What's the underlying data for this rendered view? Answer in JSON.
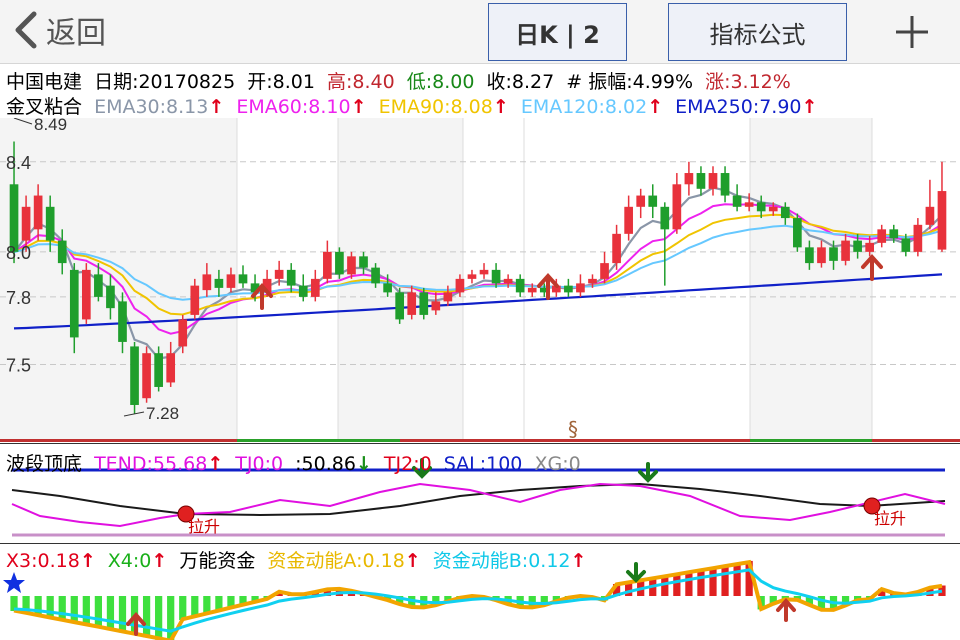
{
  "nav": {
    "back_label": "返回",
    "period_label": "日K | 2",
    "formula_label": "指标公式",
    "add_icon": "plus-icon",
    "back_icon": "chevron-left-icon"
  },
  "quote": {
    "name": "中国电建",
    "date_label": "日期:20170825",
    "open_label": "开:8.01",
    "high_label": "高:8.40",
    "low_label": "低:8.00",
    "close_label": "收:8.27",
    "amp_label": "# 振幅:4.99%",
    "chg_label": "涨:3.12%"
  },
  "indicator": {
    "name": "金叉粘合",
    "ema30": "EMA30:8.13",
    "ema60": "EMA60:8.10",
    "ema90": "EMA90:8.08",
    "ema120": "EMA120:8.02",
    "ema250": "EMA250:7.90",
    "arrow": "↑"
  },
  "colors": {
    "up": "#e8323c",
    "down": "#1f9e2c",
    "ema30": "#8a96a8",
    "ema60": "#ee22ee",
    "ema90": "#f0c400",
    "ema120": "#66c8ff",
    "ema250": "#1020c8",
    "bg_band": "#efefef"
  },
  "main_chart": {
    "y_ticks": [
      "8.4",
      "8.0",
      "7.8",
      "7.5"
    ],
    "high_marker": "8.49",
    "low_marker": "7.28",
    "section_mark": "§"
  },
  "chart_data": [
    {
      "type": "candlestick",
      "title": "中国电建",
      "ylim": [
        7.2,
        8.55
      ],
      "count": 78,
      "candles": [
        [
          8.3,
          8.0,
          8.49,
          7.95
        ],
        [
          8.05,
          8.2,
          8.25,
          8.0
        ],
        [
          8.1,
          8.25,
          8.3,
          8.05
        ],
        [
          8.2,
          8.05,
          8.25,
          8.0
        ],
        [
          8.05,
          7.95,
          8.1,
          7.9
        ],
        [
          7.92,
          7.62,
          7.95,
          7.55
        ],
        [
          7.7,
          7.92,
          7.95,
          7.68
        ],
        [
          7.9,
          7.8,
          7.95,
          7.78
        ],
        [
          7.85,
          7.75,
          7.9,
          7.7
        ],
        [
          7.78,
          7.6,
          7.82,
          7.55
        ],
        [
          7.58,
          7.32,
          7.6,
          7.28
        ],
        [
          7.35,
          7.55,
          7.58,
          7.33
        ],
        [
          7.55,
          7.4,
          7.58,
          7.38
        ],
        [
          7.42,
          7.55,
          7.6,
          7.4
        ],
        [
          7.58,
          7.7,
          7.72,
          7.55
        ],
        [
          7.72,
          7.85,
          7.88,
          7.7
        ],
        [
          7.83,
          7.9,
          7.95,
          7.8
        ],
        [
          7.88,
          7.84,
          7.92,
          7.8
        ],
        [
          7.84,
          7.9,
          7.93,
          7.82
        ],
        [
          7.9,
          7.86,
          7.94,
          7.84
        ],
        [
          7.86,
          7.82,
          7.9,
          7.78
        ],
        [
          7.82,
          7.88,
          7.92,
          7.8
        ],
        [
          7.88,
          7.92,
          7.96,
          7.85
        ],
        [
          7.92,
          7.85,
          7.95,
          7.82
        ],
        [
          7.85,
          7.8,
          7.9,
          7.78
        ],
        [
          7.8,
          7.88,
          7.92,
          7.78
        ],
        [
          7.88,
          8.0,
          8.05,
          7.86
        ],
        [
          8.0,
          7.9,
          8.02,
          7.88
        ],
        [
          7.9,
          7.98,
          8.0,
          7.88
        ],
        [
          7.98,
          7.93,
          8.0,
          7.9
        ],
        [
          7.93,
          7.86,
          7.95,
          7.84
        ],
        [
          7.86,
          7.82,
          7.9,
          7.8
        ],
        [
          7.82,
          7.7,
          7.84,
          7.68
        ],
        [
          7.72,
          7.82,
          7.85,
          7.7
        ],
        [
          7.82,
          7.72,
          7.84,
          7.7
        ],
        [
          7.74,
          7.78,
          7.82,
          7.72
        ],
        [
          7.78,
          7.82,
          7.85,
          7.76
        ],
        [
          7.82,
          7.88,
          7.9,
          7.8
        ],
        [
          7.88,
          7.9,
          7.92,
          7.86
        ],
        [
          7.9,
          7.92,
          7.95,
          7.88
        ],
        [
          7.92,
          7.86,
          7.95,
          7.84
        ],
        [
          7.86,
          7.88,
          7.9,
          7.84
        ],
        [
          7.88,
          7.82,
          7.9,
          7.8
        ],
        [
          7.82,
          7.84,
          7.86,
          7.8
        ],
        [
          7.84,
          7.82,
          7.86,
          7.8
        ],
        [
          7.82,
          7.85,
          7.88,
          7.8
        ],
        [
          7.85,
          7.82,
          7.88,
          7.8
        ],
        [
          7.82,
          7.86,
          7.9,
          7.8
        ],
        [
          7.86,
          7.88,
          7.9,
          7.84
        ],
        [
          7.88,
          7.95,
          8.0,
          7.86
        ],
        [
          7.95,
          8.08,
          8.12,
          7.92
        ],
        [
          8.08,
          8.2,
          8.25,
          8.05
        ],
        [
          8.2,
          8.25,
          8.28,
          8.15
        ],
        [
          8.25,
          8.2,
          8.3,
          8.15
        ],
        [
          8.2,
          8.1,
          8.22,
          7.85
        ],
        [
          8.1,
          8.3,
          8.35,
          8.08
        ],
        [
          8.3,
          8.35,
          8.4,
          8.25
        ],
        [
          8.35,
          8.28,
          8.38,
          8.25
        ],
        [
          8.28,
          8.35,
          8.38,
          8.25
        ],
        [
          8.35,
          8.25,
          8.38,
          8.22
        ],
        [
          8.25,
          8.2,
          8.3,
          8.18
        ],
        [
          8.2,
          8.22,
          8.26,
          8.18
        ],
        [
          8.22,
          8.18,
          8.25,
          8.15
        ],
        [
          8.18,
          8.2,
          8.22,
          8.16
        ],
        [
          8.2,
          8.15,
          8.22,
          8.12
        ],
        [
          8.15,
          8.02,
          8.17,
          8.0
        ],
        [
          8.02,
          7.95,
          8.05,
          7.92
        ],
        [
          7.95,
          8.02,
          8.05,
          7.93
        ],
        [
          8.02,
          7.96,
          8.05,
          7.92
        ],
        [
          7.96,
          8.05,
          8.08,
          7.94
        ],
        [
          8.05,
          8.0,
          8.08,
          7.97
        ],
        [
          8.0,
          8.04,
          8.07,
          7.98
        ],
        [
          8.04,
          8.1,
          8.12,
          8.02
        ],
        [
          8.1,
          8.06,
          8.12,
          8.04
        ],
        [
          8.06,
          8.0,
          8.08,
          7.98
        ],
        [
          8.0,
          8.12,
          8.15,
          7.98
        ],
        [
          8.12,
          8.2,
          8.32,
          8.1
        ],
        [
          8.01,
          8.27,
          8.4,
          8.0
        ]
      ]
    }
  ],
  "sub1": {
    "name": "波段顶底",
    "tend": "TEND:55.68",
    "tj0": "TJ0:0",
    "val": ":50.86",
    "tj2": "TJ2:0",
    "sal": "SAL:100",
    "xg": "XG:0",
    "up_arrow": "↑",
    "down_arrow": "↓",
    "signal_label": "拉升"
  },
  "sub2": {
    "x3": "X3:0.18",
    "x4": "X4:0",
    "name": "万能资金",
    "a": "资金动能A:0.18",
    "b": "资金动能B:0.12",
    "up_arrow": "↑",
    "star_icon": "star-icon"
  }
}
